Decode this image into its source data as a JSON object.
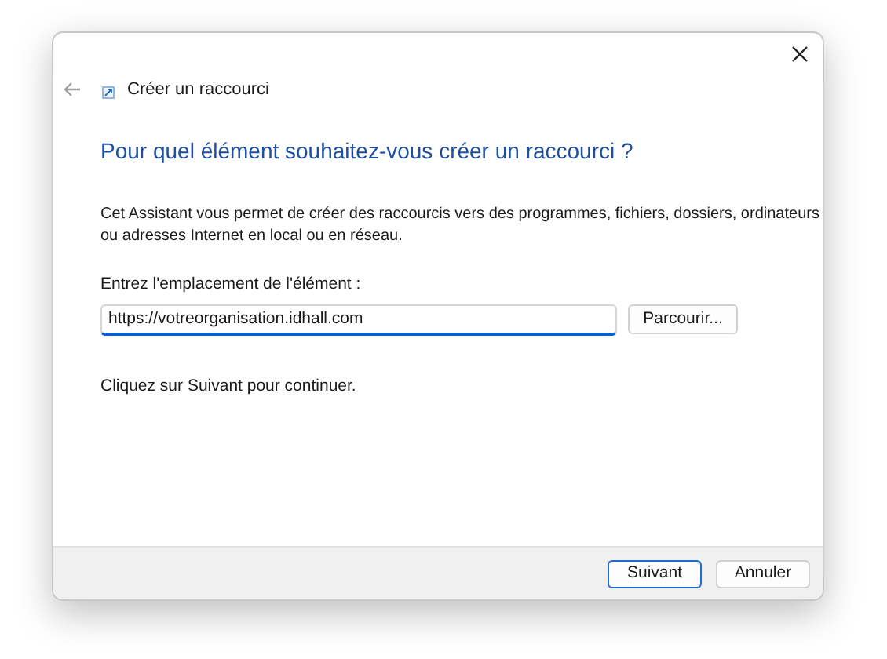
{
  "window": {
    "title": "Créer un raccourci",
    "back_disabled": true
  },
  "heading": "Pour quel élément souhaitez-vous créer un raccourci ?",
  "description": "Cet Assistant vous permet de créer des raccourcis vers des programmes, fichiers, dossiers, ordinateurs ou adresses Internet en local ou en réseau.",
  "location": {
    "label": "Entrez l'emplacement de l'élément :",
    "value": "https://votreorganisation.idhall.com",
    "browse": "Parcourir..."
  },
  "hint": "Cliquez sur Suivant pour continuer.",
  "buttons": [
    {
      "label": "Suivant",
      "default": true
    },
    {
      "label": "Annuler",
      "default": false
    }
  ]
}
